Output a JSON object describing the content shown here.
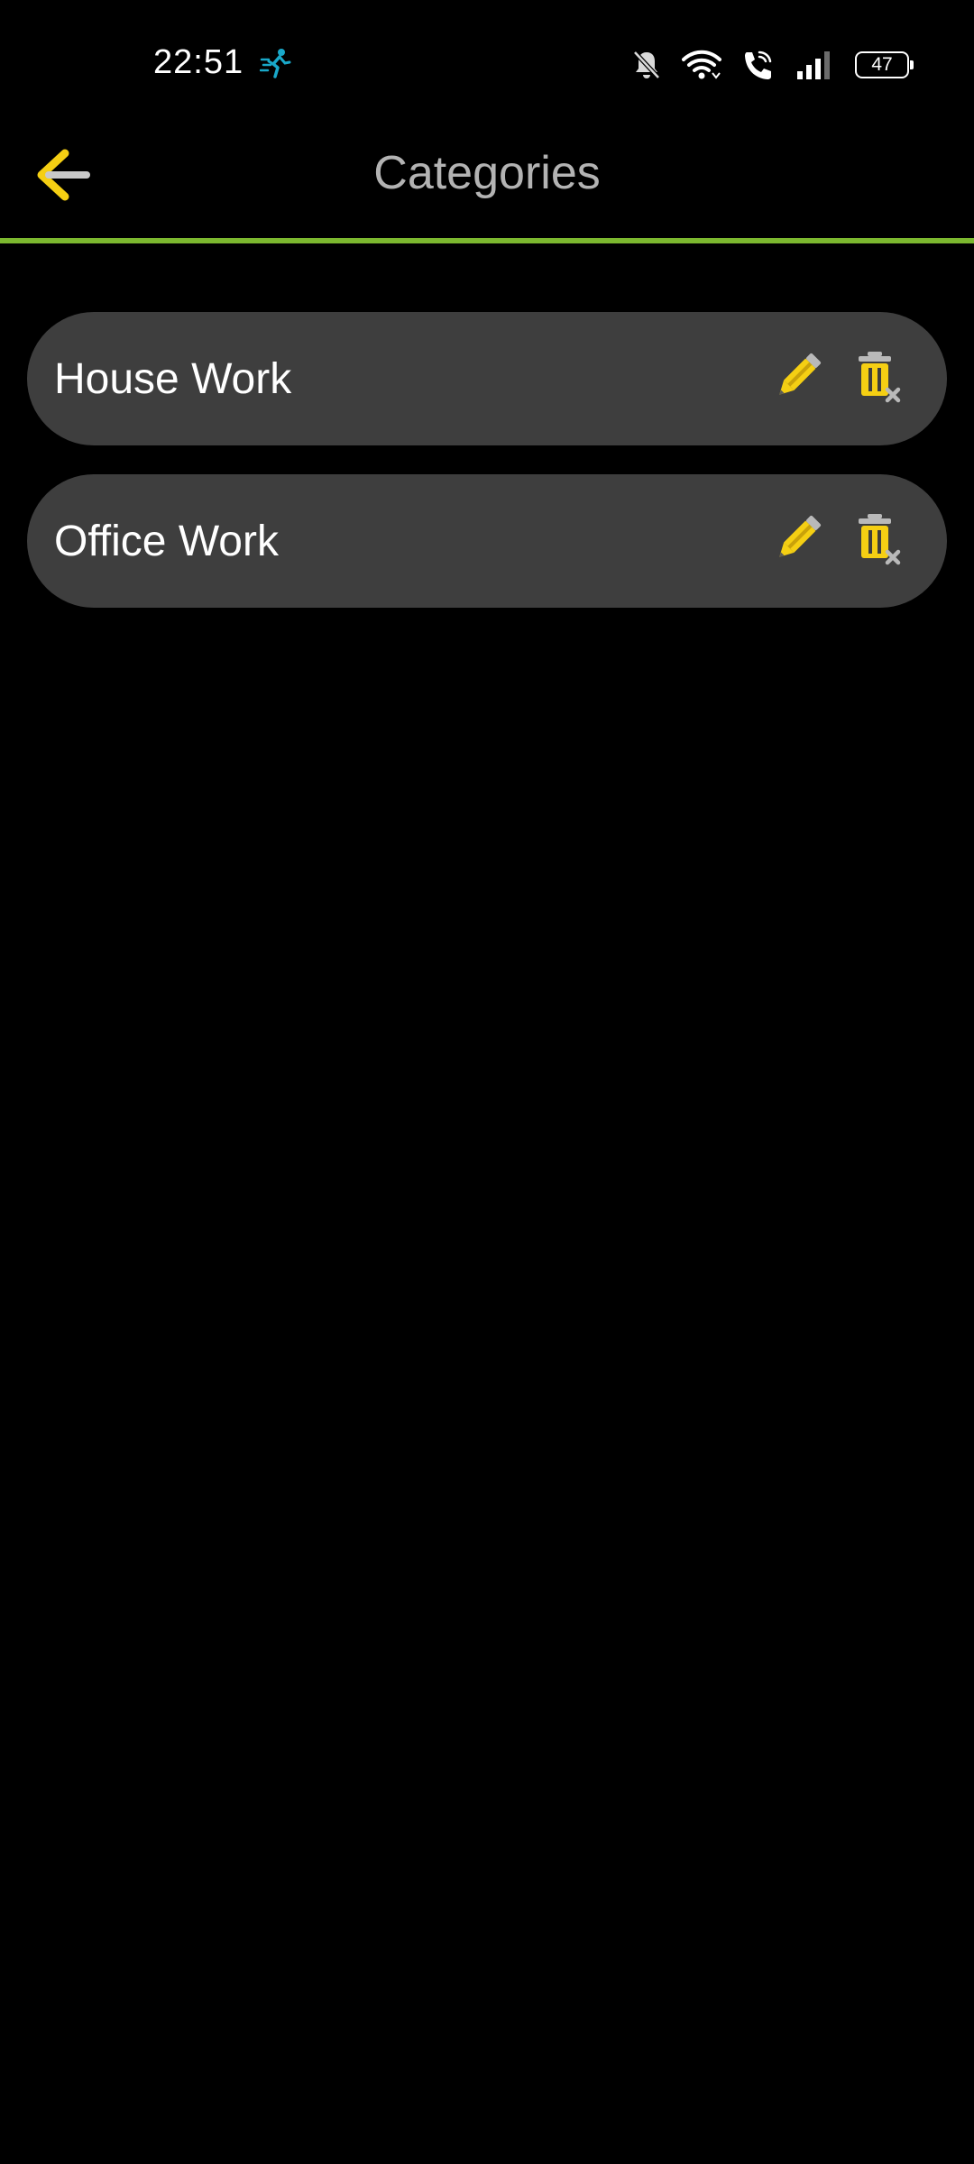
{
  "status_bar": {
    "time": "22:51",
    "battery": "47",
    "icons": [
      "activity-runner-icon",
      "bell-muted-icon",
      "wifi-icon",
      "wifi-call-icon",
      "signal-icon",
      "battery-icon"
    ]
  },
  "app_bar": {
    "title": "Categories",
    "back_icon": "arrow-left-icon"
  },
  "categories": [
    {
      "name": "House Work",
      "edit_icon": "pencil-icon",
      "delete_icon": "trash-delete-icon"
    },
    {
      "name": "Office Work",
      "edit_icon": "pencil-icon",
      "delete_icon": "trash-delete-icon"
    }
  ],
  "colors": {
    "background": "#000000",
    "accent_yellow": "#f5cf13",
    "divider_green": "#7cb82f",
    "card": "#3e3e3e",
    "title_gray": "#b3b3b3"
  }
}
